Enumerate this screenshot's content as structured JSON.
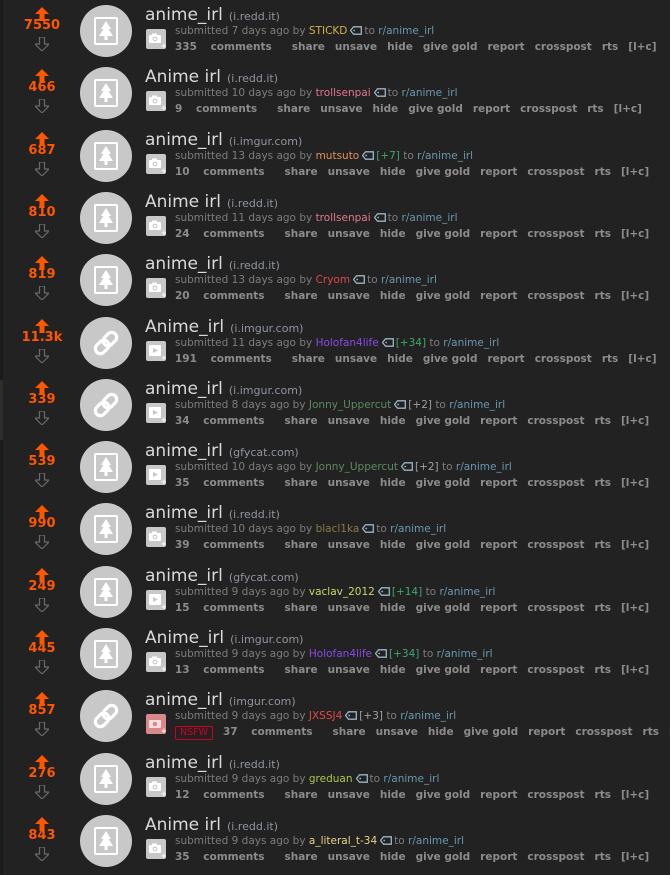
{
  "colors": {
    "background": "#222222",
    "score": "#ff5700",
    "title": "#dadada",
    "domain": "#8f95a0",
    "tagline": "#7d7d7d",
    "subreddit": "#6a98af",
    "buttons": "#8c8c8c",
    "nsfw": "#d10023"
  },
  "labels": {
    "submitted_prefix": "submitted",
    "by": "by",
    "to": "to",
    "comments_suffix": "comments",
    "share": "share",
    "unsave": "unsave",
    "hide": "hide",
    "give_gold": "give gold",
    "report": "report",
    "crosspost": "crosspost",
    "rts": "rts",
    "link_ctx": "[l+c]",
    "nsfw": "NSFW"
  },
  "posts": [
    {
      "score": "7550",
      "title": "anime_irl",
      "domain": "(i.redd.it)",
      "age": "7 days ago",
      "author": "STICKD",
      "author_color": "#d0b24a",
      "karma": "",
      "subreddit": "r/anime_irl",
      "comments": "335",
      "thumb": "image",
      "expando": "image",
      "nsfw": false
    },
    {
      "score": "466",
      "title": "Anime irl",
      "domain": "(i.redd.it)",
      "age": "10 days ago",
      "author": "trollsenpai",
      "author_color": "#e07a8a",
      "karma": "",
      "subreddit": "r/anime_irl",
      "comments": "9",
      "thumb": "image",
      "expando": "image",
      "nsfw": false
    },
    {
      "score": "687",
      "title": "anime_irl",
      "domain": "(i.imgur.com)",
      "age": "13 days ago",
      "author": "mutsuto",
      "author_color": "#e28f5a",
      "karma": "[+7]",
      "karma_color": "#3fa86a",
      "subreddit": "r/anime_irl",
      "comments": "10",
      "thumb": "image",
      "expando": "image",
      "nsfw": false
    },
    {
      "score": "810",
      "title": "Anime irl",
      "domain": "(i.redd.it)",
      "age": "11 days ago",
      "author": "trollsenpai",
      "author_color": "#e07a8a",
      "karma": "",
      "subreddit": "r/anime_irl",
      "comments": "24",
      "thumb": "image",
      "expando": "image",
      "nsfw": false
    },
    {
      "score": "819",
      "title": "anime_irl",
      "domain": "(i.redd.it)",
      "age": "13 days ago",
      "author": "Cryom",
      "author_color": "#e04a4a",
      "karma": "",
      "subreddit": "r/anime_irl",
      "comments": "20",
      "thumb": "image",
      "expando": "image",
      "nsfw": false
    },
    {
      "score": "11.3k",
      "title": "Anime_irl",
      "domain": "(i.imgur.com)",
      "age": "11 days ago",
      "author": "Holofan4life",
      "author_color": "#8a4ae8",
      "karma": "[+34]",
      "karma_color": "#3fa86a",
      "subreddit": "r/anime_irl",
      "comments": "191",
      "thumb": "link",
      "expando": "video",
      "nsfw": false
    },
    {
      "score": "339",
      "title": "anime_irl",
      "domain": "(i.imgur.com)",
      "age": "8 days ago",
      "author": "Jonny_Uppercut",
      "author_color": "#5e8a5e",
      "karma": "[+2]",
      "karma_color": "#a0a0a0",
      "subreddit": "r/anime_irl",
      "comments": "34",
      "thumb": "link",
      "expando": "video",
      "nsfw": false
    },
    {
      "score": "539",
      "title": "anime_irl",
      "domain": "(gfycat.com)",
      "age": "10 days ago",
      "author": "Jonny_Uppercut",
      "author_color": "#5e8a5e",
      "karma": "[+2]",
      "karma_color": "#a0a0a0",
      "subreddit": "r/anime_irl",
      "comments": "35",
      "thumb": "image",
      "expando": "video",
      "nsfw": false
    },
    {
      "score": "990",
      "title": "anime_irl",
      "domain": "(i.redd.it)",
      "age": "10 days ago",
      "author": "blacl1ka",
      "author_color": "#8a7a4a",
      "karma": "",
      "subreddit": "r/anime_irl",
      "comments": "39",
      "thumb": "image",
      "expando": "image",
      "nsfw": false
    },
    {
      "score": "249",
      "title": "anime_irl",
      "domain": "(gfycat.com)",
      "age": "9 days ago",
      "author": "vaclav_2012",
      "author_color": "#c8d86a",
      "karma": "[+14]",
      "karma_color": "#3fa86a",
      "subreddit": "r/anime_irl",
      "comments": "15",
      "thumb": "image",
      "expando": "video",
      "nsfw": false
    },
    {
      "score": "445",
      "title": "Anime_irl",
      "domain": "(i.imgur.com)",
      "age": "9 days ago",
      "author": "Holofan4life",
      "author_color": "#8a4ae8",
      "karma": "[+34]",
      "karma_color": "#3fa86a",
      "subreddit": "r/anime_irl",
      "comments": "13",
      "thumb": "image",
      "expando": "image",
      "nsfw": false
    },
    {
      "score": "857",
      "title": "anime_irl",
      "domain": "(imgur.com)",
      "age": "9 days ago",
      "author": "JXSSJ4",
      "author_color": "#e04a4a",
      "karma": "[+3]",
      "karma_color": "#a0a0a0",
      "subreddit": "r/anime_irl",
      "comments": "37",
      "thumb": "link",
      "expando": "image-nsfw",
      "nsfw": true
    },
    {
      "score": "276",
      "title": "anime_irl",
      "domain": "(i.redd.it)",
      "age": "9 days ago",
      "author": "greduan",
      "author_color": "#a8c84a",
      "karma": "",
      "subreddit": "r/anime_irl",
      "comments": "12",
      "thumb": "image",
      "expando": "image",
      "nsfw": false
    },
    {
      "score": "843",
      "title": "Anime irl",
      "domain": "(i.redd.it)",
      "age": "9 days ago",
      "author": "a_literal_t-34",
      "author_color": "#e8d28a",
      "karma": "",
      "subreddit": "r/anime_irl",
      "comments": "35",
      "thumb": "image",
      "expando": "image",
      "nsfw": false
    }
  ]
}
